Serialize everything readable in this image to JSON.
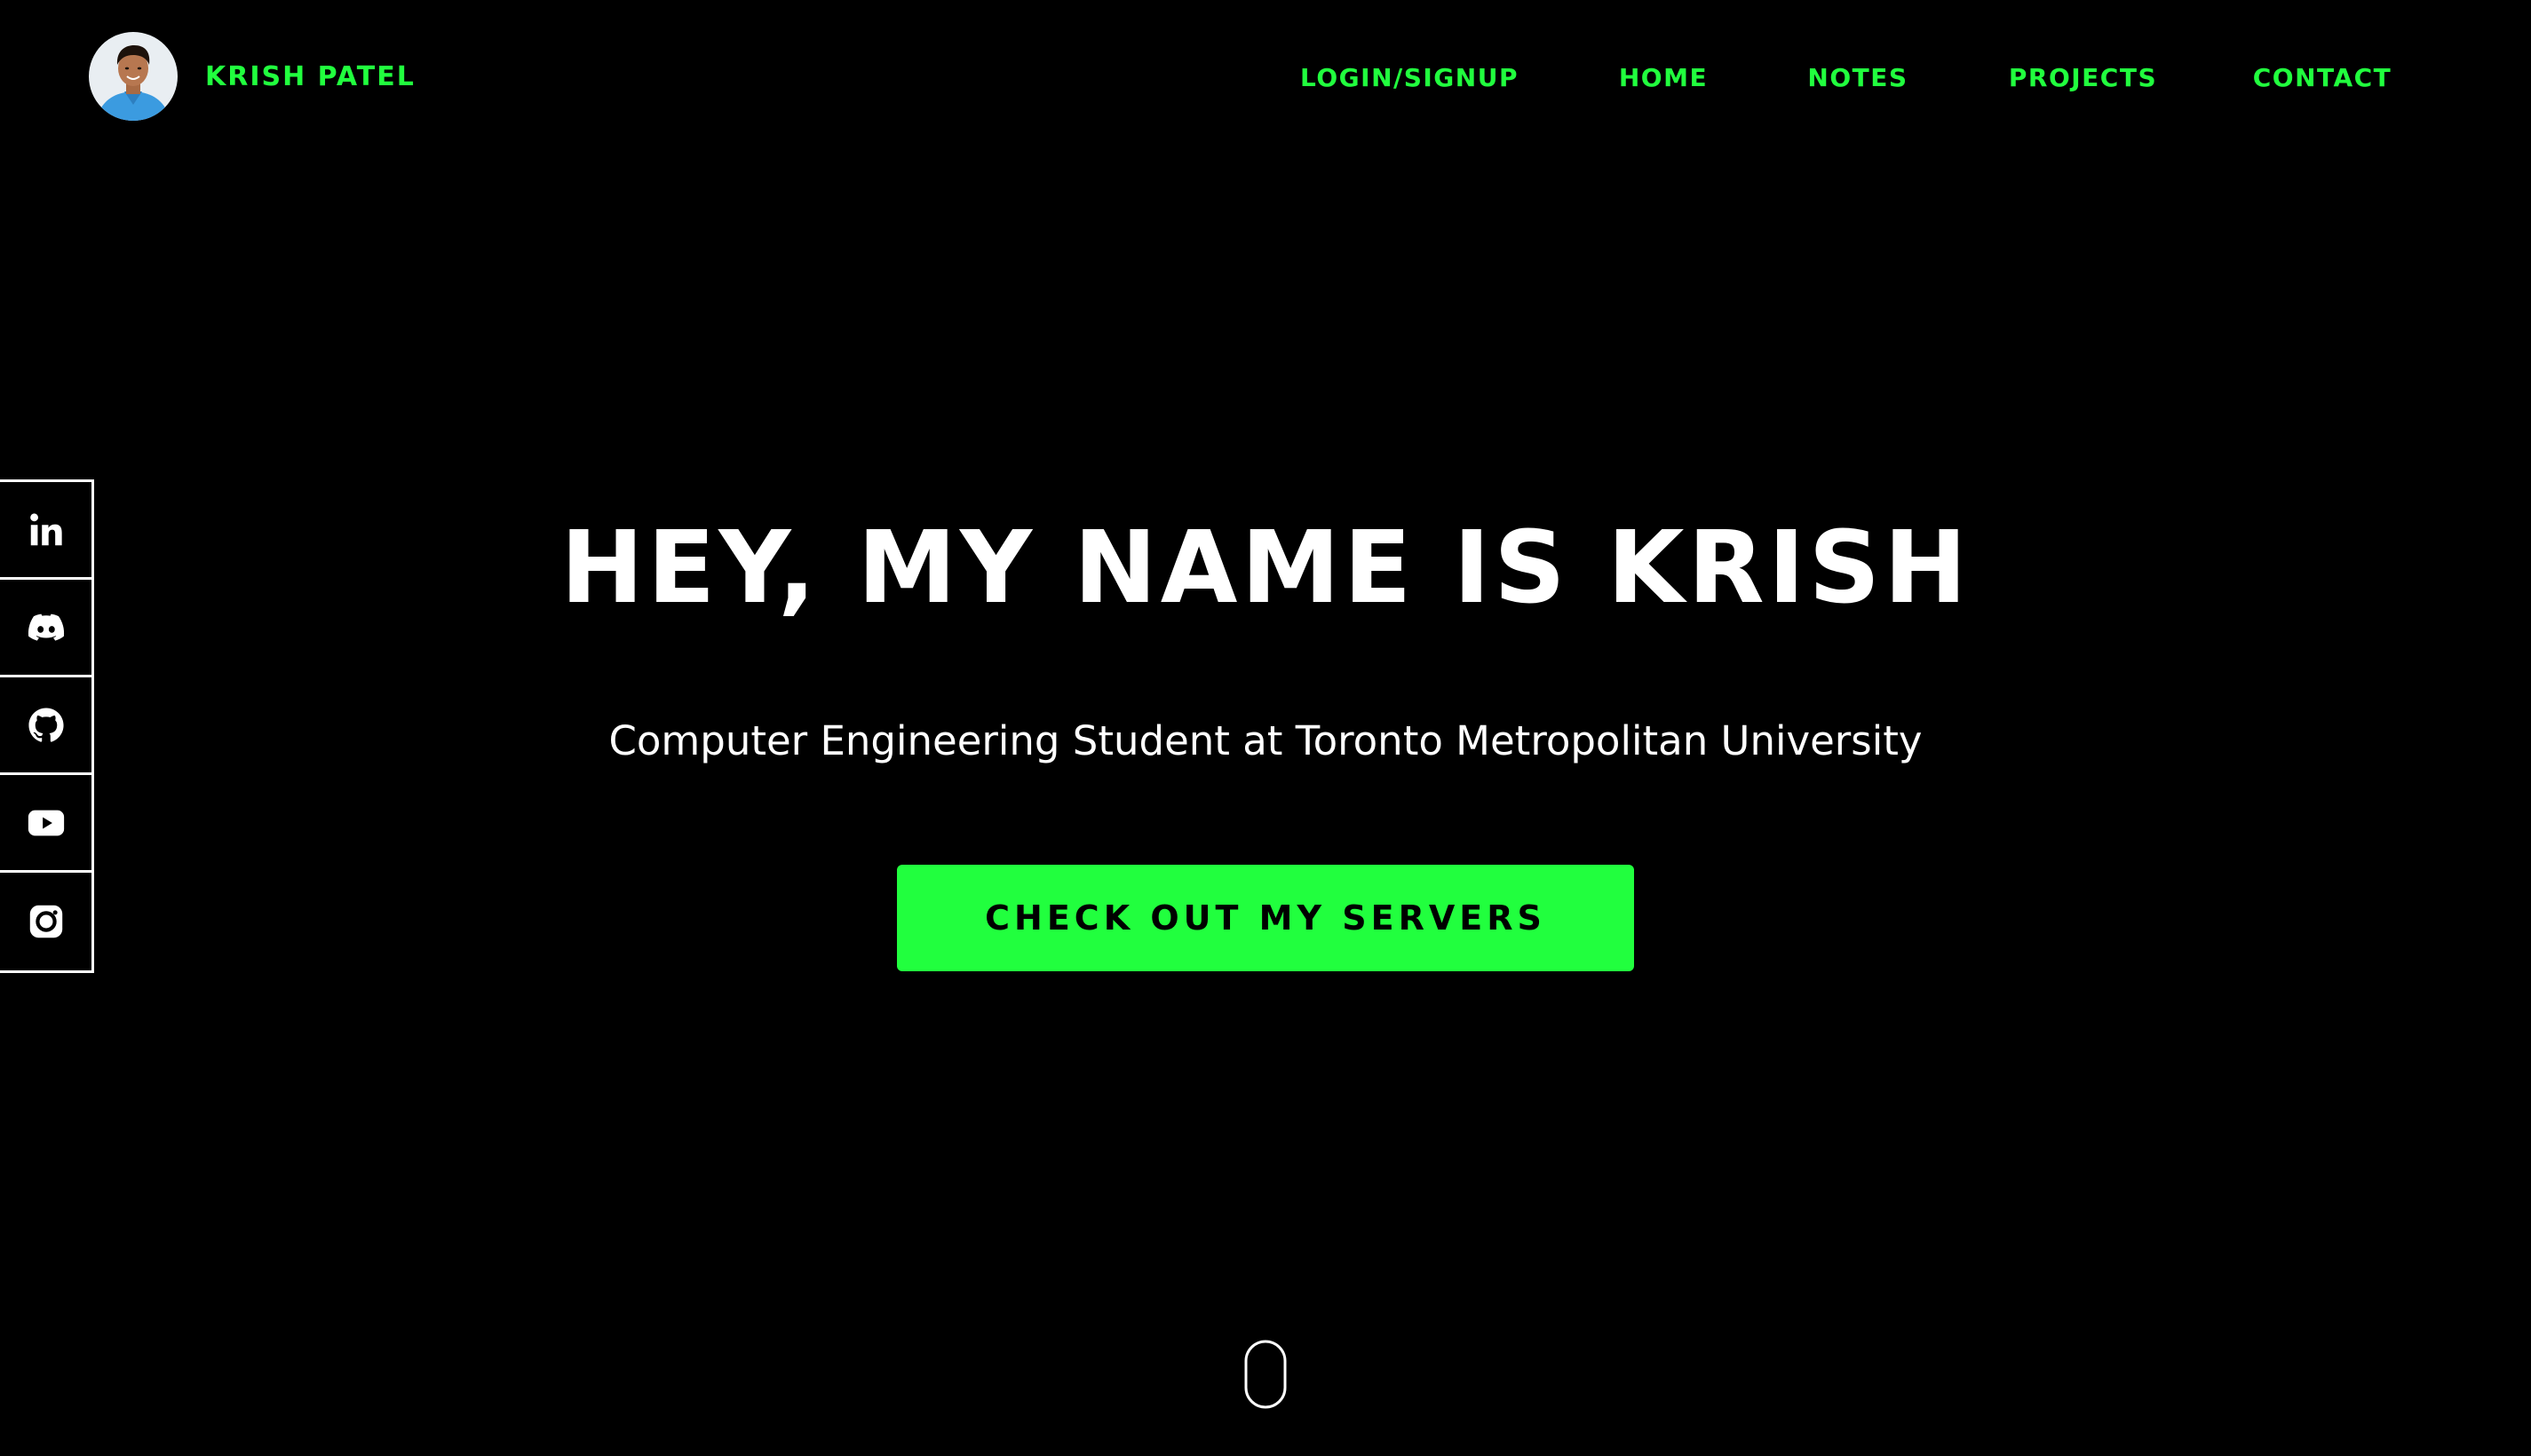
{
  "header": {
    "brand_name": "KRISH PATEL",
    "avatar_alt": "Krish Patel profile photo",
    "nav": [
      {
        "label": "LOGIN/SIGNUP"
      },
      {
        "label": "HOME"
      },
      {
        "label": "NOTES"
      },
      {
        "label": "PROJECTS"
      },
      {
        "label": "CONTACT"
      }
    ]
  },
  "social": [
    {
      "icon": "linkedin-icon"
    },
    {
      "icon": "discord-icon"
    },
    {
      "icon": "github-icon"
    },
    {
      "icon": "youtube-icon"
    },
    {
      "icon": "instagram-icon"
    }
  ],
  "hero": {
    "title": "HEY, MY NAME IS KRISH",
    "subtitle": "Computer Engineering Student at Toronto Metropolitan University",
    "cta_label": "CHECK OUT MY SERVERS"
  },
  "scroll_indicator": {
    "icon": "mouse-scroll-icon"
  },
  "colors": {
    "background": "#000000",
    "accent": "#21ff3e",
    "text": "#ffffff"
  }
}
